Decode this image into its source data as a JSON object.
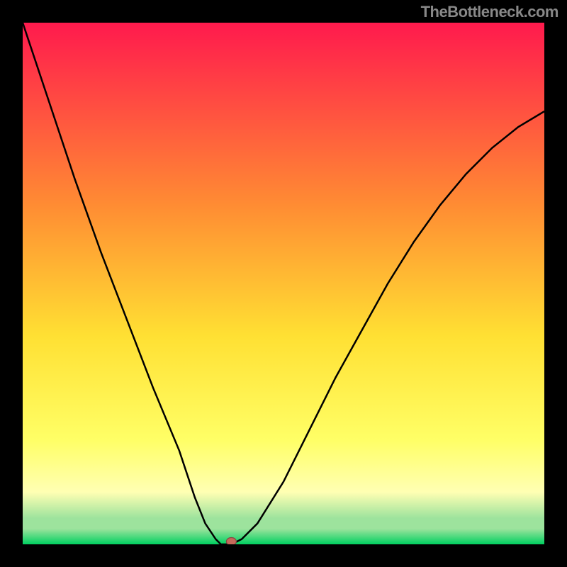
{
  "attribution": "TheBottleneck.com",
  "colors": {
    "frame": "#000000",
    "top_red": "#ff1a4d",
    "mid_orange": "#ff8c33",
    "mid_yellow": "#ffe033",
    "lower_yellow": "#ffff66",
    "pale_yellow": "#ffffb3",
    "green_band": "#9de39d",
    "bottom_green": "#00d060",
    "curve": "#000000",
    "marker_fill": "#c46a5a",
    "marker_stroke": "#884444"
  },
  "chart_data": {
    "type": "line",
    "title": "",
    "xlabel": "",
    "ylabel": "",
    "xlim": [
      0,
      100
    ],
    "ylim": [
      0,
      100
    ],
    "x": [
      0,
      5,
      10,
      15,
      20,
      25,
      30,
      33,
      35,
      37,
      38,
      40,
      42,
      45,
      50,
      55,
      60,
      65,
      70,
      75,
      80,
      85,
      90,
      95,
      100
    ],
    "values": [
      100,
      85,
      70,
      56,
      43,
      30,
      18,
      9,
      4,
      1,
      0,
      0,
      1,
      4,
      12,
      22,
      32,
      41,
      50,
      58,
      65,
      71,
      76,
      80,
      83
    ],
    "marker": {
      "x": 40,
      "y": 0
    }
  }
}
